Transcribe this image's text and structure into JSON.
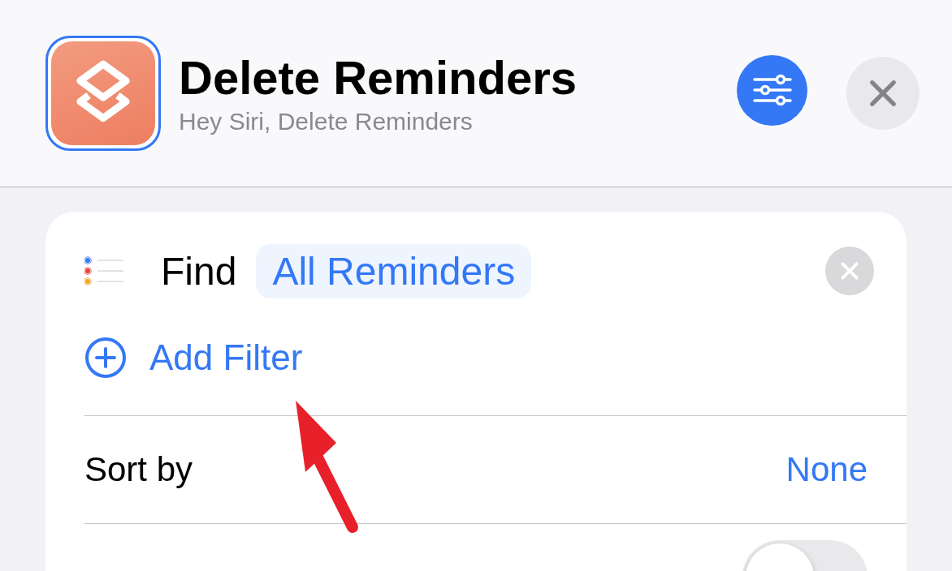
{
  "header": {
    "title": "Delete Reminders",
    "subtitle": "Hey Siri, Delete Reminders"
  },
  "action": {
    "verb": "Find",
    "parameter": "All Reminders",
    "add_filter": "Add Filter"
  },
  "rows": [
    {
      "kind": "value",
      "label": "Sort by",
      "value": "None"
    },
    {
      "kind": "toggle",
      "on": false
    }
  ]
}
